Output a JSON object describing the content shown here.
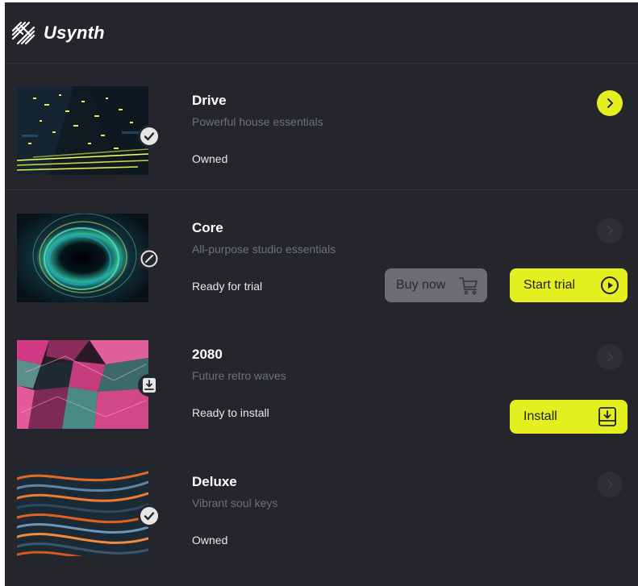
{
  "app": {
    "brand": "Usynth",
    "logo_icon": "usynth-logo-icon",
    "accent_color": "#e3ef1e",
    "background_color": "#24262b"
  },
  "products": [
    {
      "id": "drive",
      "title": "Drive",
      "subtitle": "Powerful house essentials",
      "status": "Owned",
      "badge_icon": "check-icon",
      "arrow_icon": "chevron-right-icon",
      "arrow_active": true
    },
    {
      "id": "core",
      "title": "Core",
      "subtitle": "All-purpose studio essentials",
      "status": "Ready for trial",
      "badge_icon": "disabled-icon",
      "arrow_icon": "chevron-right-icon",
      "arrow_active": false,
      "buy_label": "Buy now",
      "buy_icon": "cart-icon",
      "trial_label": "Start trial",
      "trial_icon": "play-icon"
    },
    {
      "id": "2080",
      "title": "2080",
      "subtitle": "Future retro waves",
      "status": "Ready to install",
      "badge_icon": "download-icon",
      "arrow_icon": "chevron-right-icon",
      "arrow_active": false,
      "install_label": "Install",
      "install_icon": "download-icon"
    },
    {
      "id": "deluxe",
      "title": "Deluxe",
      "subtitle": "Vibrant soul keys",
      "status": "Owned",
      "badge_icon": "check-icon",
      "arrow_icon": "chevron-right-icon",
      "arrow_active": false
    }
  ]
}
